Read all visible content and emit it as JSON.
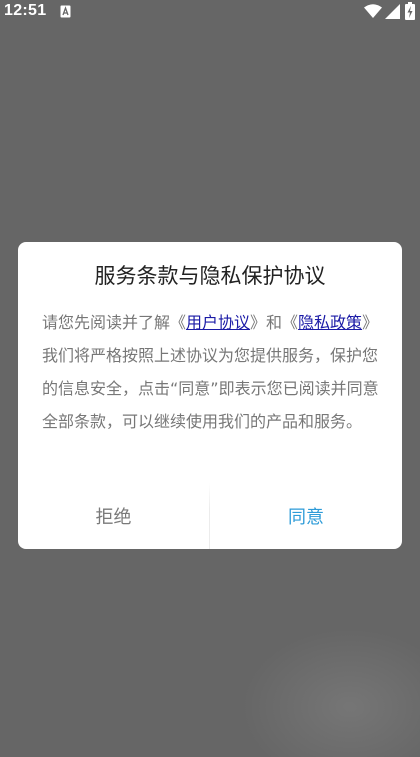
{
  "status_bar": {
    "time": "12:51",
    "notification_icon": "a-notification-icon",
    "wifi_icon": "wifi-icon",
    "signal_icon": "signal-icon",
    "battery_icon": "battery-charging-icon"
  },
  "dialog": {
    "title": "服务条款与隐私保护协议",
    "body": {
      "part1": "请您先阅读并了解《",
      "link_user_agreement": "用户协议",
      "part2": "》和《",
      "link_privacy_policy": "隐私政策",
      "part3": "》我们将严格按照上述协议为您提供服务，保护您的信息安全，点击“同意”即表示您已阅读并同意全部条款，可以继续使用我们的产品和服务。"
    },
    "buttons": {
      "decline": "拒绝",
      "accept": "同意"
    }
  },
  "colors": {
    "overlay": "#666666",
    "accept": "#2d9bd8",
    "link": "#1a1aa6",
    "body_text": "#777777"
  }
}
